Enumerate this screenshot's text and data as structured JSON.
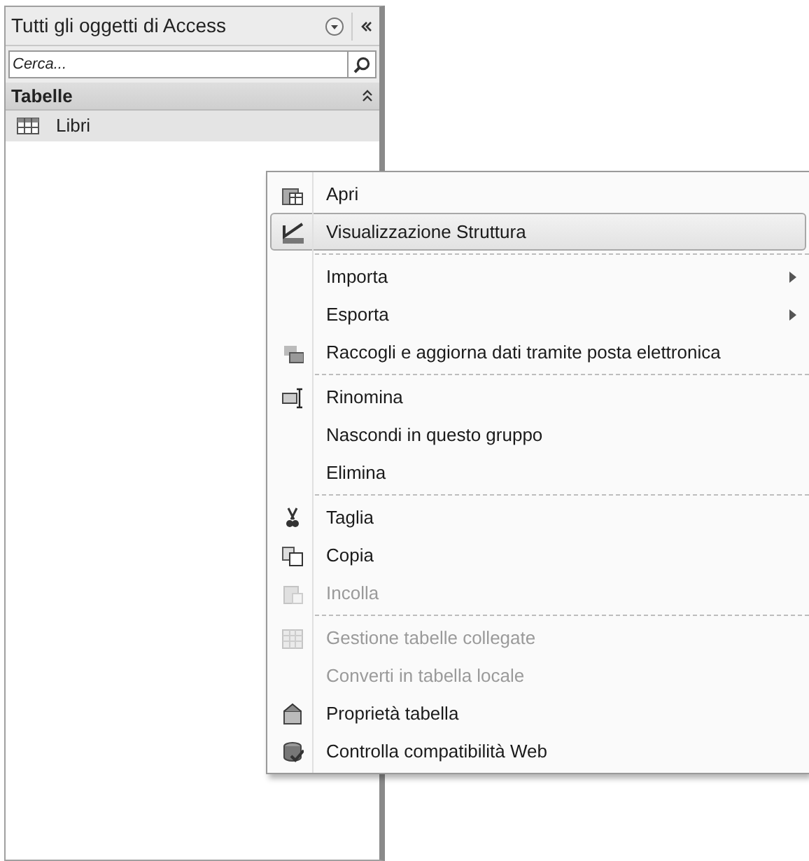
{
  "nav_pane": {
    "title": "Tutti gli oggetti di Access",
    "search": {
      "placeholder": "Cerca..."
    },
    "groups": [
      {
        "label": "Tabelle",
        "expanded": true,
        "items": [
          {
            "label": "Libri",
            "selected": true
          }
        ]
      }
    ]
  },
  "context_menu": {
    "items": [
      {
        "kind": "item",
        "label": "Apri",
        "selected": false,
        "disabled": false,
        "submenu": false
      },
      {
        "kind": "item",
        "label": "Visualizzazione Struttura",
        "selected": true,
        "disabled": false,
        "submenu": false
      },
      {
        "kind": "separator"
      },
      {
        "kind": "item",
        "label": "Importa",
        "selected": false,
        "disabled": false,
        "submenu": true
      },
      {
        "kind": "item",
        "label": "Esporta",
        "selected": false,
        "disabled": false,
        "submenu": true
      },
      {
        "kind": "item",
        "label": "Raccogli e aggiorna dati tramite posta elettronica",
        "selected": false,
        "disabled": false,
        "submenu": false
      },
      {
        "kind": "separator"
      },
      {
        "kind": "item",
        "label": "Rinomina",
        "selected": false,
        "disabled": false,
        "submenu": false
      },
      {
        "kind": "item",
        "label": "Nascondi in questo gruppo",
        "selected": false,
        "disabled": false,
        "submenu": false
      },
      {
        "kind": "item",
        "label": "Elimina",
        "selected": false,
        "disabled": false,
        "submenu": false
      },
      {
        "kind": "separator"
      },
      {
        "kind": "item",
        "label": "Taglia",
        "selected": false,
        "disabled": false,
        "submenu": false
      },
      {
        "kind": "item",
        "label": "Copia",
        "selected": false,
        "disabled": false,
        "submenu": false
      },
      {
        "kind": "item",
        "label": "Incolla",
        "selected": false,
        "disabled": true,
        "submenu": false
      },
      {
        "kind": "separator"
      },
      {
        "kind": "item",
        "label": "Gestione tabelle collegate",
        "selected": false,
        "disabled": true,
        "submenu": false
      },
      {
        "kind": "item",
        "label": "Converti in tabella locale",
        "selected": false,
        "disabled": true,
        "submenu": false
      },
      {
        "kind": "item",
        "label": "Proprietà tabella",
        "selected": false,
        "disabled": false,
        "submenu": false
      },
      {
        "kind": "item",
        "label": "Controlla compatibilità Web",
        "selected": false,
        "disabled": false,
        "submenu": false
      }
    ]
  }
}
